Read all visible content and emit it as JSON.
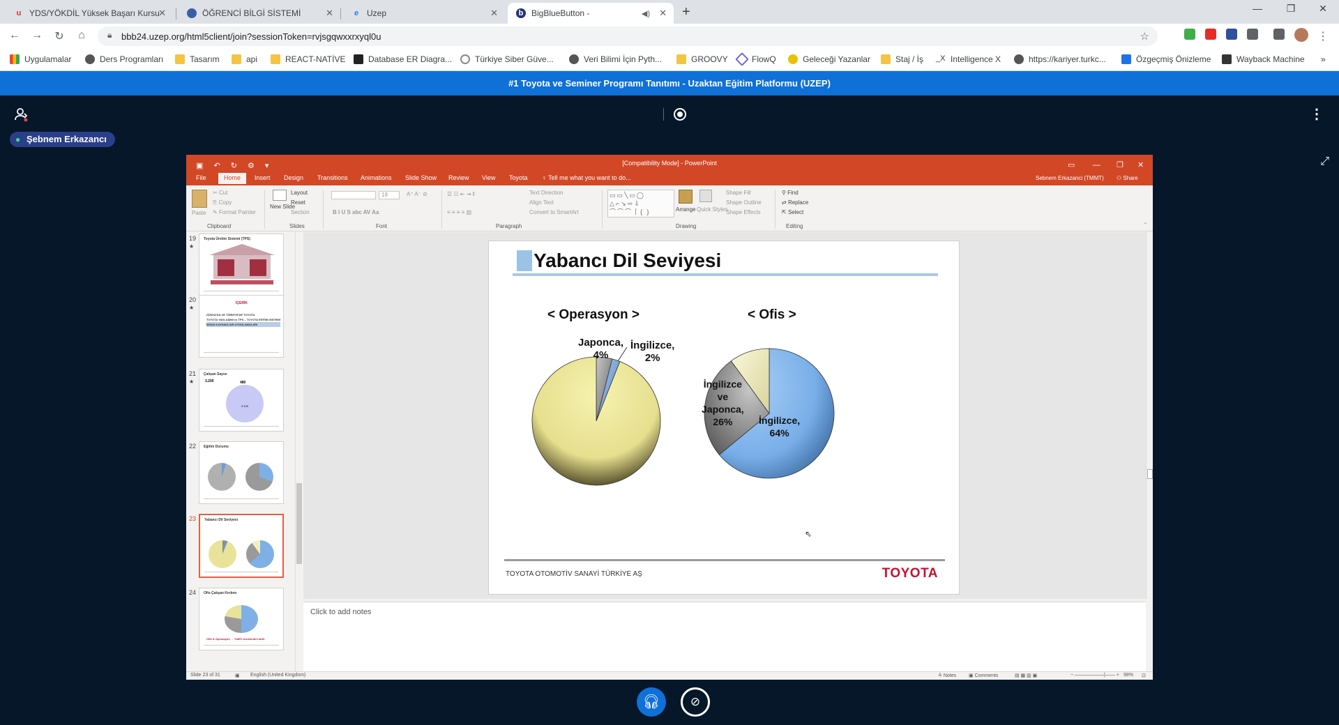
{
  "browser": {
    "tabs": [
      {
        "title": "YDS/YÖKDİL Yüksek Başarı Kursu",
        "icon": "u-icon",
        "active": false
      },
      {
        "title": "ÖĞRENCİ BİLGİ SİSTEMİ",
        "icon": "globe-icon",
        "active": false
      },
      {
        "title": "Uzep",
        "icon": "ie-icon",
        "active": false
      },
      {
        "title": "BigBlueButton -",
        "icon": "bbb-icon",
        "active": true
      }
    ],
    "url": "bbb24.uzep.org/html5client/join?sessionToken=rvjsgqwxxrxyql0u",
    "bookmarks": [
      "Uygulamalar",
      "Ders Programları",
      "Tasarım",
      "api",
      "REACT-NATİVE",
      "Database ER Diagra...",
      "Türkiye Siber Güve...",
      "Veri Bilimi İçin Pyth...",
      "GROOVY",
      "FlowQ",
      "Geleceği Yazanlar",
      "Staj / İş",
      "Intelligence X",
      "https://kariyer.turkc...",
      "Özgeçmiş Önizleme",
      "Wayback Machine"
    ],
    "more_bookmarks": "»"
  },
  "bbb": {
    "header_title": "#1 Toyota ve Seminer Programı Tanıtımı - Uzaktan Eğitim Platformu (UZEP)",
    "presenter_name": "Şebnem Erkazancı"
  },
  "powerpoint": {
    "window_title": "[Compatibility Mode] - PowerPoint",
    "user": "Sebnem Erkazanci (TMMT)",
    "share_label": "Share",
    "menu_tabs": [
      "File",
      "Home",
      "Insert",
      "Design",
      "Transitions",
      "Animations",
      "Slide Show",
      "Review",
      "View",
      "Toyota"
    ],
    "tell_me": "Tell me what you want to do...",
    "ribbon": {
      "clipboard": {
        "group": "Clipboard",
        "paste": "Paste",
        "cut": "Cut",
        "copy": "Copy",
        "format_painter": "Format Painter"
      },
      "slides": {
        "group": "Slides",
        "new_slide": "New Slide",
        "layout": "Layout",
        "reset": "Reset",
        "section": "Section"
      },
      "font": {
        "group": "Font",
        "size": "18"
      },
      "paragraph": {
        "group": "Paragraph",
        "text_direction": "Text Direction",
        "align_text": "Align Text",
        "convert": "Convert to SmartArt"
      },
      "drawing": {
        "group": "Drawing",
        "arrange": "Arrange",
        "quick_styles": "Quick Styles",
        "shape_fill": "Shape Fill",
        "shape_outline": "Shape Outline",
        "shape_effects": "Shape Effects"
      },
      "editing": {
        "group": "Editing",
        "find": "Find",
        "replace": "Replace",
        "select": "Select"
      }
    },
    "thumbnails": [
      {
        "num": "19",
        "title": "Toyota Üretim Sistemi (TPS)"
      },
      {
        "num": "20",
        "title": "İÇERİK"
      },
      {
        "num": "21",
        "title": "Çalışan Sayısı"
      },
      {
        "num": "22",
        "title": "Eğitim Durumu"
      },
      {
        "num": "23",
        "title": "Yabancı Dil Seviyesi"
      },
      {
        "num": "24",
        "title": "Ofis Çalışan Kırılımı"
      }
    ],
    "thumb_texts": {
      "t20_items": [
        "DÜNYA'DA VE TÜRKİYE'DE TOYOTA",
        "TOYOTA YAKLAŞIMI ve TPS – TOYOTA EĞİTİM SİSTEMİ",
        "İNSAN KAYNAKLARI UYGULAMALARI"
      ],
      "t21_values": [
        "3.200",
        "480",
        "3.100"
      ],
      "t24_caption": "Ofis & Operasyon → %80% tesislerden tarih"
    },
    "slide": {
      "title": "Yabancı Dil Seviyesi",
      "footer_text": "TOYOTA OTOMOTİV SANAYİ TÜRKİYE AŞ",
      "logo": "TOYOTA"
    },
    "notes_placeholder": "Click to add notes",
    "status": {
      "slide": "Slide 23 of 31",
      "language": "English (United Kingdom)",
      "notes": "Notes",
      "comments": "Comments",
      "zoom": "98%"
    }
  },
  "chart_data": [
    {
      "type": "pie",
      "title": "< Operasyon >",
      "slices": [
        {
          "label": "Japonca,\n4%",
          "value": 4,
          "color": "#8c8c8c"
        },
        {
          "label": "İngilizce,\n2%",
          "value": 2,
          "color": "#6a9ed8"
        },
        {
          "label": "",
          "value": 94,
          "color": "#e9e39a"
        }
      ]
    },
    {
      "type": "pie",
      "title": "< Ofis >",
      "slices": [
        {
          "label": "İngilizce,\n64%",
          "value": 64,
          "color": "#7eb0e6"
        },
        {
          "label": "İngilizce\nve\nJaponca,\n26%",
          "value": 26,
          "color": "#9a9a9a"
        },
        {
          "label": "",
          "value": 10,
          "color": "#f1eec0"
        }
      ]
    }
  ]
}
